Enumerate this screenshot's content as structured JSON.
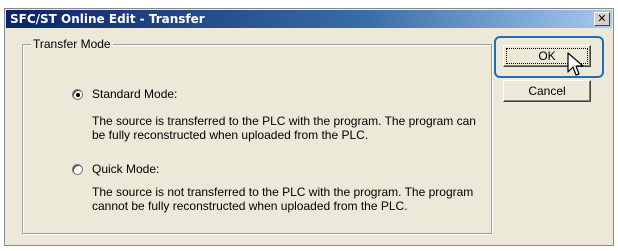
{
  "window": {
    "title": "SFC/ST Online Edit - Transfer",
    "close_glyph": "✕"
  },
  "group": {
    "legend": "Transfer Mode"
  },
  "options": {
    "standard": {
      "label": "Standard Mode:",
      "checked": true,
      "description": "The source is transferred to the PLC with the program. The program can be fully reconstructed when uploaded from the PLC."
    },
    "quick": {
      "label": "Quick Mode:",
      "checked": false,
      "description": "The source is not transferred to the PLC with the program. The program cannot be fully reconstructed when uploaded from the PLC."
    }
  },
  "buttons": {
    "ok_label": "OK",
    "cancel_label": "Cancel"
  },
  "colors": {
    "highlight": "#1f6fb8",
    "titlebar_start": "#0a246a",
    "dialog_bg": "#ece9d8"
  },
  "icons": {
    "cursor": "mouse-pointer-icon"
  }
}
